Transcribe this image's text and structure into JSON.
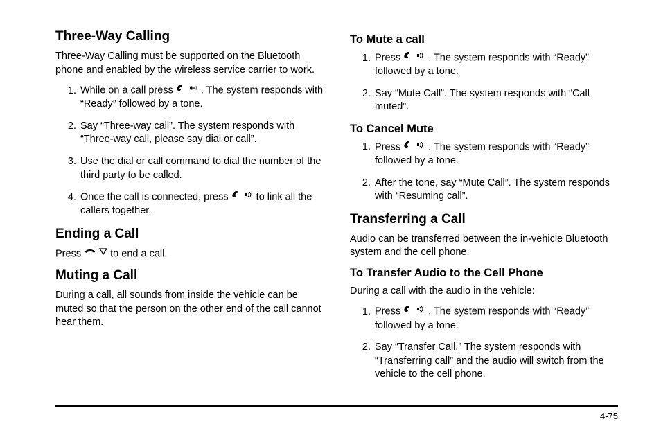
{
  "left": {
    "h_threeway": "Three-Way Calling",
    "p_threeway": "Three-Way Calling must be supported on the Bluetooth phone and enabled by the wireless service carrier to work.",
    "threeway_steps": {
      "s1a": "While on a call press ",
      "s1b": " . The system responds with “Ready” followed by a tone.",
      "s2": "Say “Three-way call”. The system responds with “Three-way call, please say dial or call”.",
      "s3": "Use the dial or call command to dial the number of the third party to be called.",
      "s4a": "Once the call is connected, press ",
      "s4b": " to link all the callers together."
    },
    "h_ending": "Ending a Call",
    "p_ending_a": "Press ",
    "p_ending_b": " to end a call.",
    "h_muting": "Muting a Call",
    "p_muting": "During a call, all sounds from inside the vehicle can be muted so that the person on the other end of the call cannot hear them."
  },
  "right": {
    "h_mute": "To Mute a call",
    "mute_steps": {
      "s1a": "Press ",
      "s1b": " . The system responds with “Ready” followed by a tone.",
      "s2": "Say “Mute Call”. The system responds with “Call muted”."
    },
    "h_cancelmute": "To Cancel Mute",
    "cancel_steps": {
      "s1a": "Press ",
      "s1b": " . The system responds with “Ready” followed by a tone.",
      "s2": "After the tone, say “Mute Call”. The system responds with “Resuming call”."
    },
    "h_transfer": "Transferring a Call",
    "p_transfer": "Audio can be transferred between the in-vehicle Bluetooth system and the cell phone.",
    "h_transfer_cell": "To Transfer Audio to the Cell Phone",
    "p_transfer_cell": "During a call with the audio in the vehicle:",
    "transfer_steps": {
      "s1a": "Press ",
      "s1b": " . The system responds with “Ready” followed by a tone.",
      "s2": "Say “Transfer Call.” The system responds with “Transferring call” and the audio will switch from the vehicle to the cell phone."
    }
  },
  "page_number": "4-75"
}
